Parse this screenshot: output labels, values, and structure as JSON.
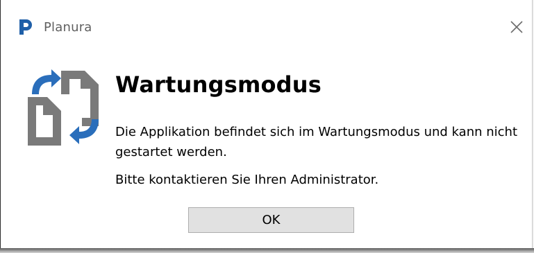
{
  "window": {
    "app_name": "Planura",
    "logo_icon": "planura-logo-icon",
    "close_icon": "close-icon",
    "brand_color": "#1f5fa8"
  },
  "dialog": {
    "icon": "sync-documents-icon",
    "heading": "Wartungsmodus",
    "message_line1": "Die Applikation befindet sich im Wartungsmodus und kann nicht gestartet werden.",
    "message_line2": "Bitte kontaktieren Sie Ihren Administrator.",
    "ok_label": "OK"
  }
}
